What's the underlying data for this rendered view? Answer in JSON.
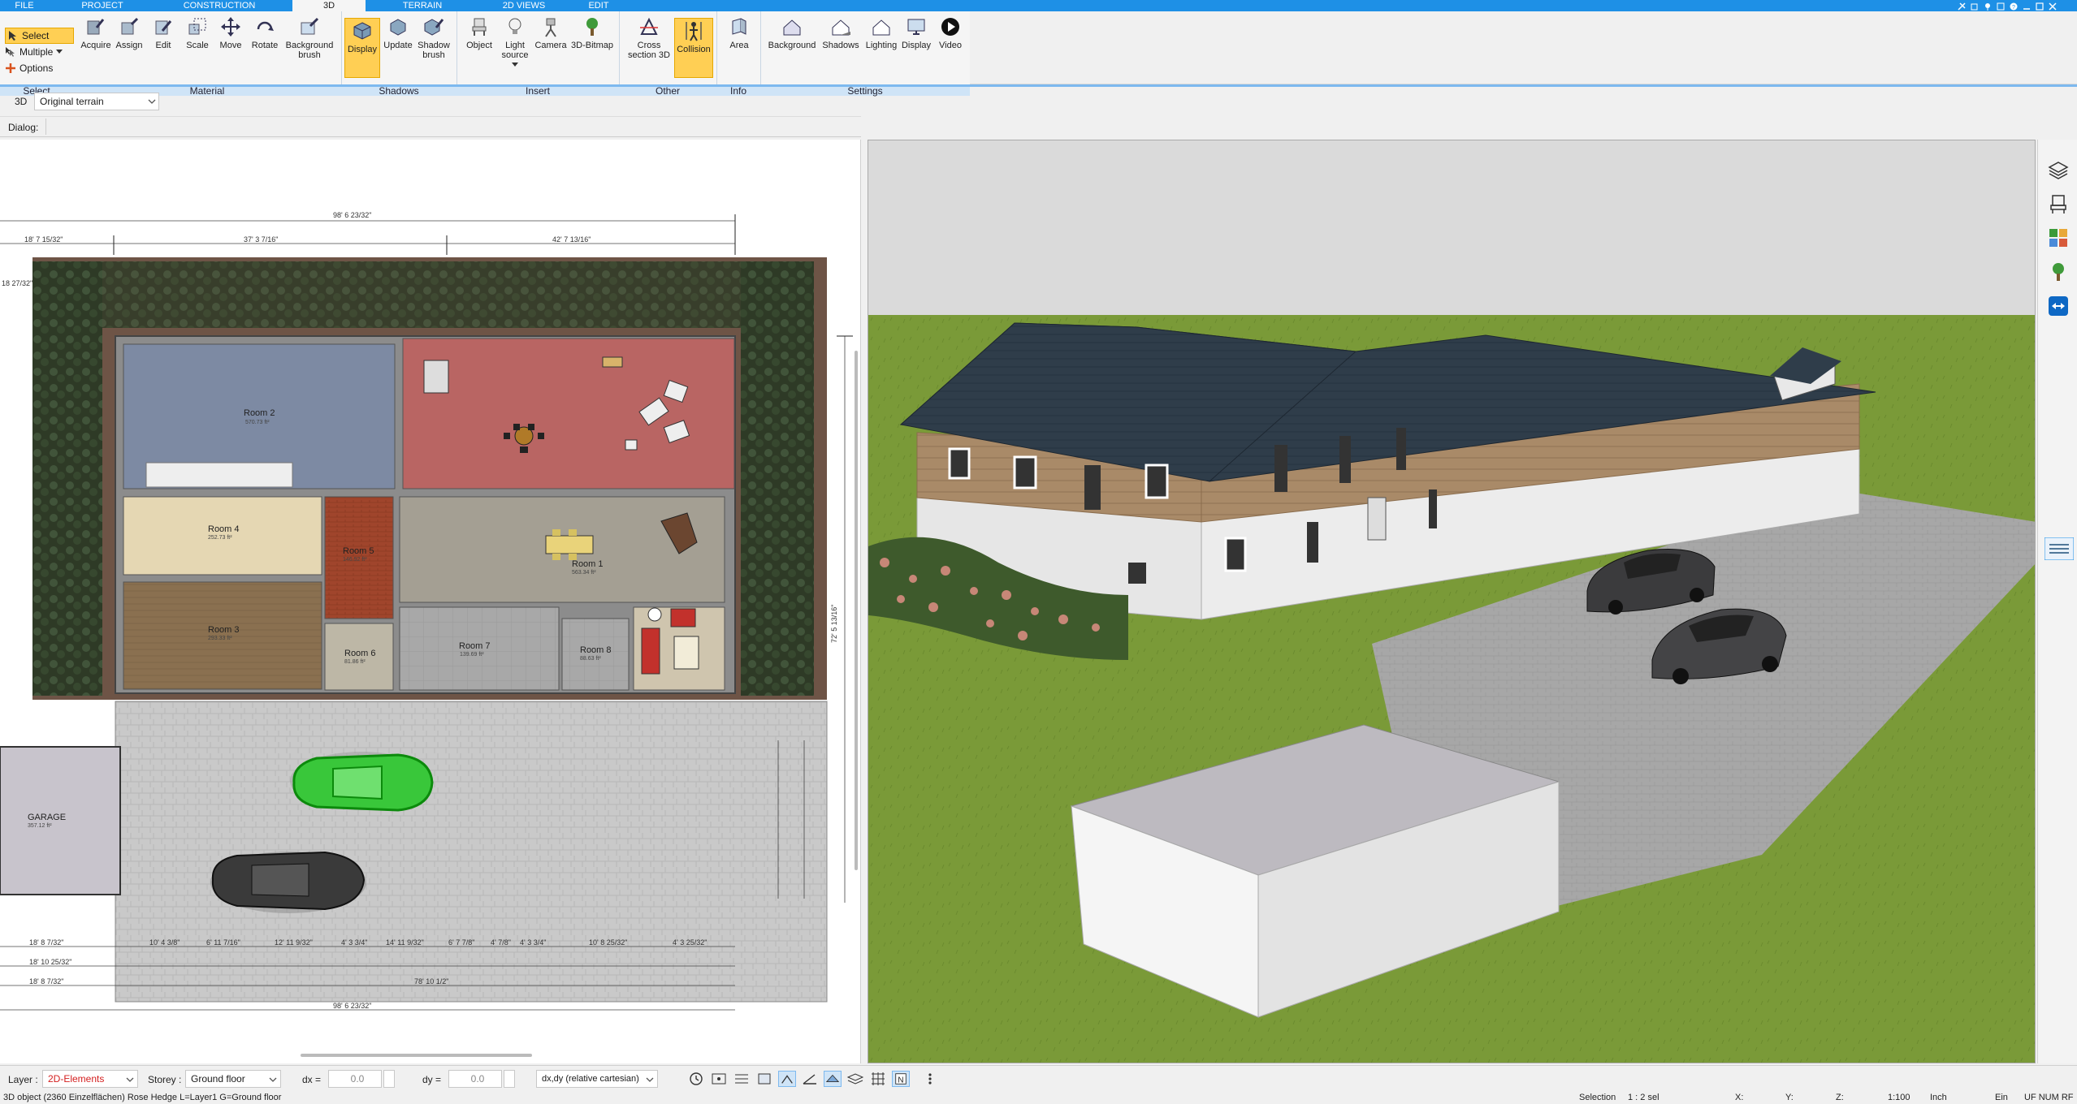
{
  "tabs": [
    "FILE",
    "PROJECT",
    "CONSTRUCTION",
    "3D",
    "TERRAIN",
    "2D VIEWS",
    "EDIT"
  ],
  "select_group": {
    "items": [
      "Select",
      "Multiple",
      "Options"
    ],
    "label": "Select"
  },
  "ribbon": {
    "material": {
      "label": "Material",
      "buttons": [
        "Acquire",
        "Assign",
        "Edit",
        "Scale",
        "Move",
        "Rotate",
        "Background brush"
      ]
    },
    "shadows": {
      "label": "Shadows",
      "buttons": [
        "Display",
        "Update",
        "Shadow brush"
      ]
    },
    "insert": {
      "label": "Insert",
      "buttons": [
        "Object",
        "Light source",
        "Camera",
        "3D-Bitmap"
      ]
    },
    "other": {
      "label": "Other",
      "buttons": [
        "Cross section 3D",
        "Collision"
      ]
    },
    "info": {
      "label": "Info",
      "buttons": [
        "Area"
      ]
    },
    "settings": {
      "label": "Settings",
      "buttons": [
        "Background",
        "Shadows",
        "Lighting",
        "Display",
        "Video"
      ]
    }
  },
  "view_selector": {
    "mode": "3D",
    "terrain": "Original terrain"
  },
  "dialog_label": "Dialog:",
  "plan": {
    "rooms": [
      {
        "name": "Room 2",
        "area": "570.73 ft²"
      },
      {
        "name": "Room 4",
        "area": "252.73 ft²"
      },
      {
        "name": "Room 3",
        "area": "293.33 ft²"
      },
      {
        "name": "Room 5",
        "area": "146.92 ft²"
      },
      {
        "name": "Room 1",
        "area": "563.34 ft²"
      },
      {
        "name": "Room 6",
        "area": "81.86 ft²"
      },
      {
        "name": "Room 7",
        "area": "139.69 ft²"
      },
      {
        "name": "Room 8",
        "area": "88.63 ft²"
      },
      {
        "name": "GARAGE",
        "area": "357.12 ft²"
      }
    ],
    "dimensions": {
      "top_total": "98' 6 23/32\"",
      "top_left": "18' 7 15/32\"",
      "top_mid": "37' 3 7/16\"",
      "top_right": "42' 7 13/16\"",
      "side": "18 27/32\"",
      "right_total": "72' 5 13/16\"",
      "bottom_1": "18' 8 7/32\"",
      "bottom_2": "18' 10 25/32\"",
      "bottom_3": "18' 8 7/32\"",
      "bottom_total_a": "78' 10 1/2\"",
      "bottom_total_b": "98' 6 23/32\"",
      "seg_1": "10' 4 3/8\"",
      "seg_2": "6' 11 7/16\"",
      "seg_3": "12' 11 9/32\"",
      "seg_4": "4' 3 3/4\"",
      "seg_5": "14' 11 9/32\"",
      "seg_6": "6' 7 7/8\"",
      "seg_7": "4' 7/8\"",
      "seg_8": "4' 3 3/4\"",
      "seg_9": "10' 8 25/32\"",
      "seg_10": "4' 3 25/32\""
    }
  },
  "bottom_toolbar": {
    "layer_label": "Layer :",
    "layer_value": "2D-Elements",
    "storey_label": "Storey :",
    "storey_value": "Ground floor",
    "dx_label": "dx =",
    "dx_value": "0.0",
    "dy_label": "dy =",
    "dy_value": "0.0",
    "coord_mode": "dx,dy (relative cartesian)"
  },
  "status": {
    "message": "3D object (2360 Einzelflächen) Rose Hedge L=Layer1 G=Ground floor",
    "selection": "Selection",
    "selection_count": "1 : 2 sel",
    "x": "X:",
    "y": "Y:",
    "z": "Z:",
    "scale": "1:100",
    "unit": "Inch",
    "ein": "Ein",
    "keys": "UF NUM RF"
  },
  "colors": {
    "accent": "#1e90e6",
    "active_button": "#ffcf54",
    "group_bar": "#cfe4f7",
    "roof": "#2f3d4a",
    "lawn": "#7a9a38"
  }
}
